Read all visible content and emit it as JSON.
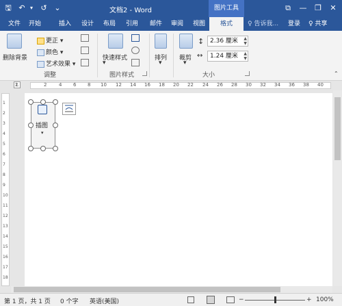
{
  "window": {
    "title": "文档2 - Word",
    "contextual_tools": "图片工具",
    "quick_access": {
      "save": "🖫",
      "undo": "↶",
      "undo_dropdown": "▾",
      "redo": "↺",
      "customize": "⌄"
    },
    "controls": {
      "ribbon_display": "⧉",
      "minimize": "—",
      "restore": "❐",
      "close": "✕"
    }
  },
  "tabs": [
    "文件",
    "开始",
    "插入",
    "设计",
    "布局",
    "引用",
    "邮件",
    "审阅",
    "视图",
    "格式"
  ],
  "active_tab": "格式",
  "search": {
    "icon": "♀",
    "placeholder": "告诉我..."
  },
  "account": {
    "login": "登录",
    "share": "共享",
    "share_icon": "♀"
  },
  "ribbon": {
    "adjust": {
      "label": "调整",
      "remove_bg": "删除背景",
      "corrections": "更正",
      "color": "颜色",
      "artistic": "艺术效果"
    },
    "styles": {
      "label": "图片样式",
      "quick_styles": "快速样式"
    },
    "arrange": {
      "label": "排列"
    },
    "size": {
      "label": "大小",
      "crop": "裁剪",
      "height": "2.36 厘米",
      "width": "1.24 厘米"
    }
  },
  "ruler": {
    "h_numbers": [
      "2",
      "2",
      "4",
      "6",
      "8",
      "10",
      "12",
      "14",
      "16",
      "18",
      "20",
      "22",
      "24",
      "26",
      "28",
      "30",
      "32",
      "34",
      "36",
      "38",
      "40"
    ],
    "v_numbers": [
      "1",
      "2",
      "3",
      "4",
      "5",
      "6",
      "7",
      "8",
      "9",
      "10",
      "11",
      "12",
      "13",
      "14",
      "15",
      "16",
      "17",
      "18"
    ]
  },
  "document": {
    "image_label": "插图",
    "image_dropdown": "▾"
  },
  "status": {
    "page": "第 1 页，共 1 页",
    "words": "0 个字",
    "language": "英语(美国)",
    "zoom_out": "−",
    "zoom_in": "+",
    "zoom": "100%"
  }
}
